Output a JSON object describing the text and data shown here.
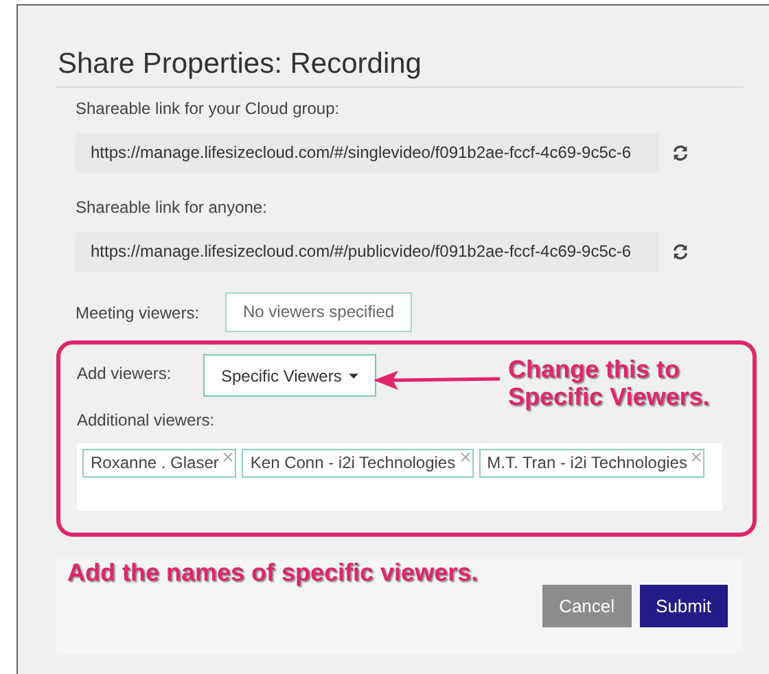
{
  "dialog": {
    "title": "Share Properties: Recording",
    "links": [
      {
        "label": "Shareable link for your Cloud group:",
        "value": "https://manage.lifesizecloud.com/#/singlevideo/f091b2ae-fccf-4c69-9c5c-6"
      },
      {
        "label": "Shareable link for anyone:",
        "value": "https://manage.lifesizecloud.com/#/publicvideo/f091b2ae-fccf-4c69-9c5c-6"
      }
    ],
    "meeting_viewers": {
      "label": "Meeting viewers:",
      "value": "No viewers specified"
    },
    "add_viewers": {
      "label": "Add viewers:",
      "value": "Specific Viewers"
    },
    "additional_viewers": {
      "label": "Additional viewers:",
      "tags": [
        "Roxanne . Glaser",
        "Ken Conn - i2i Technologies",
        "M.T. Tran - i2i Technologies"
      ]
    },
    "buttons": [
      {
        "label": "Cancel",
        "kind": "secondary"
      },
      {
        "label": "Submit",
        "kind": "primary"
      }
    ]
  },
  "annotations": [
    {
      "kind": "callout",
      "text": "Change this to Specific Viewers."
    },
    {
      "kind": "note",
      "text": "Add the names of specific viewers."
    }
  ]
}
